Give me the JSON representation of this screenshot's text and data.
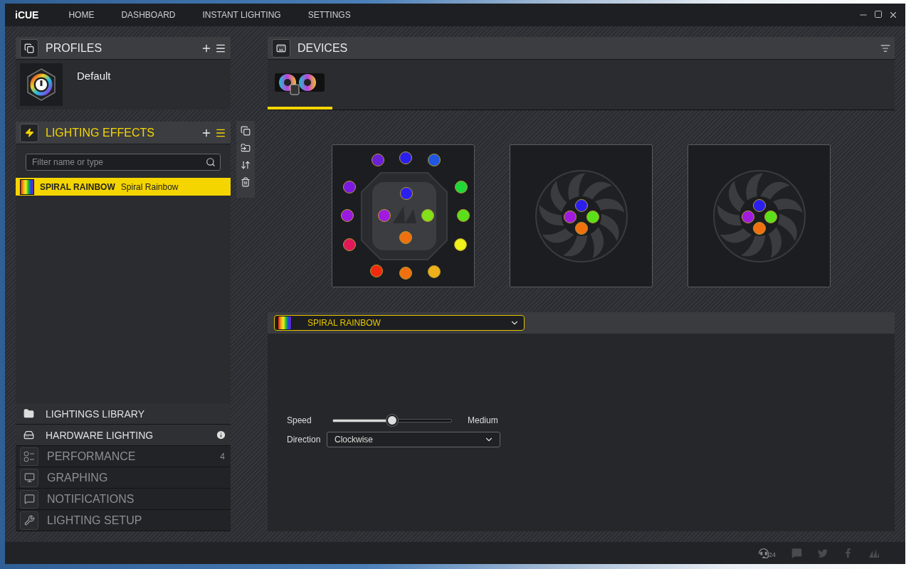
{
  "window": {
    "title": "iCUE"
  },
  "nav": [
    {
      "label": "HOME"
    },
    {
      "label": "DASHBOARD"
    },
    {
      "label": "INSTANT LIGHTING"
    },
    {
      "label": "SETTINGS"
    }
  ],
  "profiles": {
    "title": "PROFILES",
    "items": [
      {
        "name": "Default"
      }
    ]
  },
  "lighting_effects": {
    "title": "LIGHTING EFFECTS",
    "search": {
      "placeholder": "Filter name or type"
    },
    "items": [
      {
        "name": "SPIRAL RAINBOW",
        "type": "Spiral Rainbow",
        "selected": true
      }
    ]
  },
  "side_menu": [
    {
      "label": "LIGHTINGS LIBRARY",
      "kind": "tool"
    },
    {
      "label": "HARDWARE LIGHTING",
      "kind": "tool",
      "info": true
    },
    {
      "label": "PERFORMANCE",
      "kind": "module",
      "badge": "4"
    },
    {
      "label": "GRAPHING",
      "kind": "module"
    },
    {
      "label": "NOTIFICATIONS",
      "kind": "module"
    },
    {
      "label": "LIGHTING SETUP",
      "kind": "module"
    }
  ],
  "devices": {
    "title": "DEVICES",
    "tabs": [
      {
        "selected": true
      }
    ],
    "zones": [
      {
        "kind": "pump",
        "leds": [
          {
            "color": "#6a1fd8"
          },
          {
            "color": "#2b1ff0"
          },
          {
            "color": "#1f57e0"
          },
          {
            "color": "#1fd83a"
          },
          {
            "color": "#5ae01a"
          },
          {
            "color": "#f0f01a"
          },
          {
            "color": "#f0b01a"
          },
          {
            "color": "#f07010"
          },
          {
            "color": "#f02a10"
          },
          {
            "color": "#e0185a"
          },
          {
            "color": "#9a1ae0"
          },
          {
            "color": "#7a1ae0"
          },
          {
            "color": "#2b1ff0"
          },
          {
            "color": "#80e01a"
          },
          {
            "color": "#f07010"
          },
          {
            "color": "#a01ae0"
          }
        ]
      },
      {
        "kind": "fan",
        "leds": [
          {
            "color": "#2b1ff0"
          },
          {
            "color": "#5ae01a"
          },
          {
            "color": "#f07010"
          },
          {
            "color": "#a01ae0"
          }
        ]
      },
      {
        "kind": "fan",
        "leds": [
          {
            "color": "#2b1ff0"
          },
          {
            "color": "#5ae01a"
          },
          {
            "color": "#f07010"
          },
          {
            "color": "#a01ae0"
          }
        ]
      }
    ]
  },
  "effect": {
    "name": "SPIRAL RAINBOW",
    "speed": {
      "label": "Speed",
      "level": 0.5,
      "reading": "Medium"
    },
    "direction": {
      "label": "Direction",
      "value": "Clockwise"
    }
  },
  "status_bar": {
    "support_badge": "24"
  }
}
